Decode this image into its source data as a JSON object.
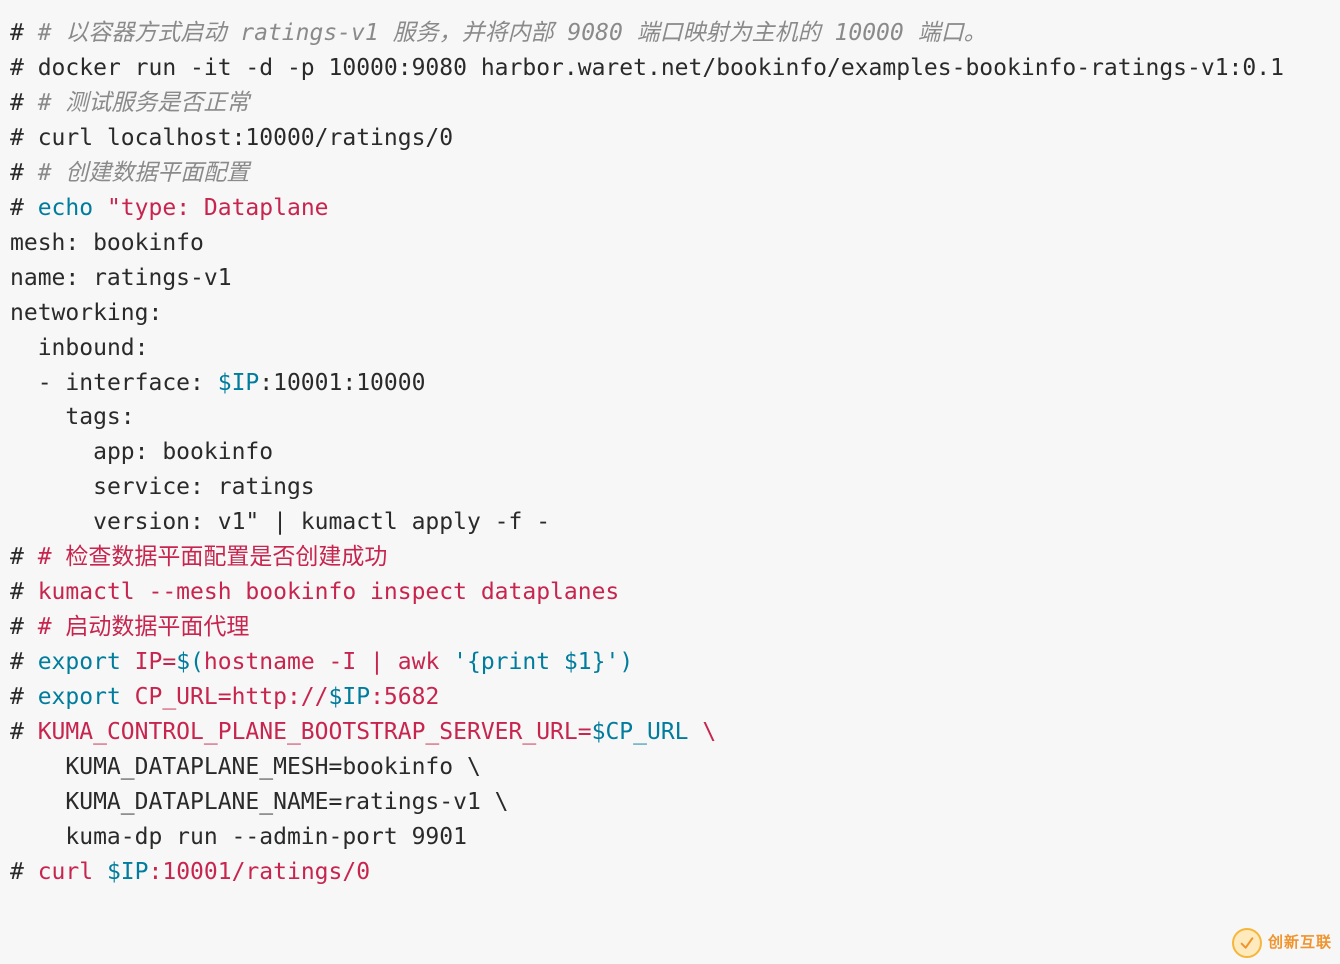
{
  "lines": [
    {
      "parts": [
        {
          "cls": "hash",
          "t": "# "
        },
        {
          "cls": "comment",
          "t": "# 以容器方式启动 ratings-v1 服务，并将内部 9080 端口映射为主机的 10000 端口。"
        }
      ]
    },
    {
      "parts": [
        {
          "cls": "hash",
          "t": "# "
        },
        {
          "cls": "plain",
          "t": "docker run -it -d -p 10000:9080 harbor.waret.net/bookinfo/examples-bookinfo-ratings-v1:0.1"
        }
      ]
    },
    {
      "parts": [
        {
          "cls": "hash",
          "t": "# "
        },
        {
          "cls": "comment",
          "t": "# 测试服务是否正常"
        }
      ]
    },
    {
      "parts": [
        {
          "cls": "hash",
          "t": "# "
        },
        {
          "cls": "plain",
          "t": "curl localhost:10000/ratings/0"
        }
      ]
    },
    {
      "parts": [
        {
          "cls": "hash",
          "t": "# "
        },
        {
          "cls": "comment",
          "t": "# 创建数据平面配置"
        }
      ]
    },
    {
      "parts": [
        {
          "cls": "hash",
          "t": "# "
        },
        {
          "cls": "cmd",
          "t": "echo"
        },
        {
          "cls": "plain",
          "t": " "
        },
        {
          "cls": "str",
          "t": "\"type: Dataplane"
        }
      ]
    },
    {
      "parts": [
        {
          "cls": "plain",
          "t": "mesh: bookinfo"
        }
      ]
    },
    {
      "parts": [
        {
          "cls": "plain",
          "t": "name: ratings-v1"
        }
      ]
    },
    {
      "parts": [
        {
          "cls": "plain",
          "t": "networking:"
        }
      ]
    },
    {
      "parts": [
        {
          "cls": "plain",
          "t": "  inbound:"
        }
      ]
    },
    {
      "parts": [
        {
          "cls": "plain",
          "t": "  - interface: "
        },
        {
          "cls": "var",
          "t": "$IP"
        },
        {
          "cls": "plain",
          "t": ":10001:10000"
        }
      ]
    },
    {
      "parts": [
        {
          "cls": "plain",
          "t": "    tags:"
        }
      ]
    },
    {
      "parts": [
        {
          "cls": "plain",
          "t": "      app: bookinfo"
        }
      ]
    },
    {
      "parts": [
        {
          "cls": "plain",
          "t": "      service: ratings"
        }
      ]
    },
    {
      "parts": [
        {
          "cls": "plain",
          "t": "      version: v1\""
        },
        {
          "cls": "plain",
          "t": " | kumactl apply -f -"
        }
      ]
    },
    {
      "parts": [
        {
          "cls": "hash",
          "t": "# "
        },
        {
          "cls": "str",
          "t": "# 检查数据平面配置是否创建成功"
        }
      ]
    },
    {
      "parts": [
        {
          "cls": "hash",
          "t": "# "
        },
        {
          "cls": "str",
          "t": "kumactl --mesh bookinfo inspect dataplanes"
        }
      ]
    },
    {
      "parts": [
        {
          "cls": "hash",
          "t": "# "
        },
        {
          "cls": "str",
          "t": "# 启动数据平面代理"
        }
      ]
    },
    {
      "parts": [
        {
          "cls": "hash",
          "t": "# "
        },
        {
          "cls": "cmd",
          "t": "export"
        },
        {
          "cls": "str",
          "t": " IP="
        },
        {
          "cls": "cmd",
          "t": "$("
        },
        {
          "cls": "str",
          "t": "hostname -I | awk "
        },
        {
          "cls": "cmd",
          "t": "'{print $1}'"
        },
        {
          "cls": "cmd",
          "t": ")"
        }
      ]
    },
    {
      "parts": [
        {
          "cls": "hash",
          "t": "# "
        },
        {
          "cls": "cmd",
          "t": "export"
        },
        {
          "cls": "str",
          "t": " CP_URL=http://"
        },
        {
          "cls": "cmd",
          "t": "$IP"
        },
        {
          "cls": "str",
          "t": ":5682"
        }
      ]
    },
    {
      "parts": [
        {
          "cls": "hash",
          "t": "# "
        },
        {
          "cls": "str",
          "t": "KUMA_CONTROL_PLANE_BOOTSTRAP_SERVER_URL="
        },
        {
          "cls": "cmd",
          "t": "$CP_URL"
        },
        {
          "cls": "str",
          "t": " \\"
        }
      ]
    },
    {
      "parts": [
        {
          "cls": "plain",
          "t": "    KUMA_DATAPLANE_MESH=bookinfo \\"
        }
      ]
    },
    {
      "parts": [
        {
          "cls": "plain",
          "t": "    KUMA_DATAPLANE_NAME=ratings-v1 \\"
        }
      ]
    },
    {
      "parts": [
        {
          "cls": "plain",
          "t": "    kuma-dp run --admin-port 9901"
        }
      ]
    },
    {
      "parts": [
        {
          "cls": "hash",
          "t": "# "
        },
        {
          "cls": "str",
          "t": "curl "
        },
        {
          "cls": "cmd",
          "t": "$IP"
        },
        {
          "cls": "str",
          "t": ":10001/ratings/0"
        }
      ]
    }
  ],
  "watermark": {
    "text": "创新互联"
  }
}
